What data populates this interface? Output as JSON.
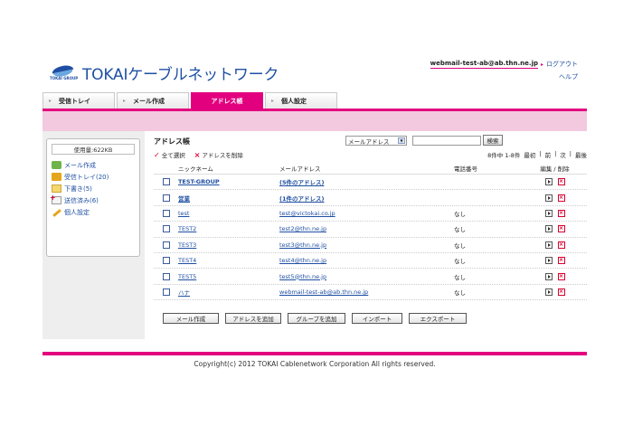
{
  "header": {
    "logo_tagline": "TOKAI GROUP",
    "logo_text": "TOKAIケーブルネットワーク",
    "user_email": "webmail-test-ab@ab.thn.ne.jp",
    "logout": "ログアウト",
    "help": "ヘルプ"
  },
  "tabs": [
    {
      "label": "受信トレイ",
      "active": false
    },
    {
      "label": "メール作成",
      "active": false
    },
    {
      "label": "アドレス帳",
      "active": true
    },
    {
      "label": "個人設定",
      "active": false
    }
  ],
  "sidebar": {
    "usage": "使用量:622KB",
    "items": [
      {
        "label": "メール作成",
        "icon": "compose-icon"
      },
      {
        "label": "受信トレイ(20)",
        "icon": "inbox-icon"
      },
      {
        "label": "下書き(5)",
        "icon": "drafts-icon"
      },
      {
        "label": "送信済み(6)",
        "icon": "sent-icon"
      },
      {
        "label": "個人設定",
        "icon": "settings-icon"
      }
    ]
  },
  "main": {
    "title": "アドレス帳",
    "filter_selected": "メールアドレス",
    "search_button": "検索",
    "select_all": "全て選択",
    "delete_selected": "アドレスを削除",
    "pager": {
      "summary": "8件中 1-8件",
      "first": "最初",
      "prev": "前",
      "next": "次",
      "last": "最後"
    },
    "columns": {
      "nickname": "ニックネーム",
      "email": "メールアドレス",
      "tel": "電話番号",
      "edit": "編集 / 削除"
    },
    "rows": [
      {
        "nickname": "TEST-GROUP",
        "email": "(5件のアドレス)",
        "tel": "",
        "group": true
      },
      {
        "nickname": "営業",
        "email": "(1件のアドレス)",
        "tel": "",
        "group": true
      },
      {
        "nickname": "test",
        "email": "test@victokai.co.jp",
        "tel": "なし",
        "group": false
      },
      {
        "nickname": "TEST2",
        "email": "test2@thn.ne.jp",
        "tel": "なし",
        "group": false
      },
      {
        "nickname": "TEST3",
        "email": "test3@thn.ne.jp",
        "tel": "なし",
        "group": false
      },
      {
        "nickname": "TEST4",
        "email": "test4@thn.ne.jp",
        "tel": "なし",
        "group": false
      },
      {
        "nickname": "TEST5",
        "email": "test5@thn.ne.jp",
        "tel": "なし",
        "group": false
      },
      {
        "nickname": "ハナ",
        "email": "webmail-test-ab@ab.thn.ne.jp",
        "tel": "なし",
        "group": false
      }
    ],
    "buttons": [
      "メール作成",
      "アドレスを追加",
      "グループを追加",
      "インポート",
      "エクスポート"
    ]
  },
  "footer": {
    "copyright": "Copyright(c) 2012 TOKAI Cablenetwork Corporation All rights reserved."
  },
  "colors": {
    "accent": "#e3007f",
    "link": "#1f4fa3",
    "band": "#f2c9de"
  }
}
